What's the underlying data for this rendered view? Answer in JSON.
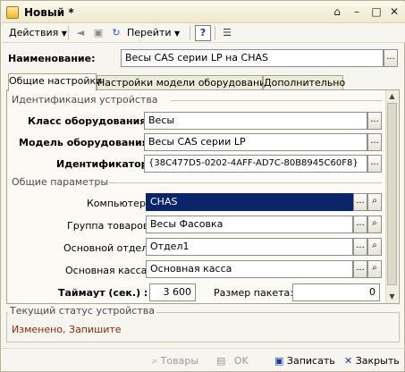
{
  "window": {
    "title": "Новый *"
  },
  "toolbar": {
    "actions_label": "Действия",
    "goto_label": "Перейти",
    "help_label": "?"
  },
  "name_row": {
    "label": "Наименование:",
    "value": "Весы CAS серии LP на CHAS"
  },
  "tabs": [
    {
      "label": "Общие настройки"
    },
    {
      "label": "Настройки модели оборудования"
    },
    {
      "label": "Дополнительно"
    }
  ],
  "device_id_section": {
    "title": "Идентификация устройства",
    "class_label": "Класс оборудования :",
    "class_value": "Весы",
    "model_label": "Модель оборудования :",
    "model_value": "Весы CAS серии LP",
    "id_label": "Идентификатор :",
    "id_value": "{38C477D5-0202-4AFF-AD7C-80B8945C60F8}"
  },
  "general_section": {
    "title": "Общие параметры",
    "computer_label": "Компьютер :",
    "computer_value": "CHAS",
    "group_label": "Группа товаров :",
    "group_value": "Весы Фасовка",
    "dept_label": "Основной отдел :",
    "dept_value": "Отдел1",
    "cash_label": "Основная касса :",
    "cash_value": "Основная касса",
    "timeout_label": "Таймаут (сек.) :",
    "timeout_value": "3 600",
    "packet_label": "Размер пакета:",
    "packet_value": "0"
  },
  "status": {
    "title": "Текущий статус устройства",
    "text": "Изменено, Запишите"
  },
  "bottom_bar": {
    "goods_label": "Товары",
    "ok_label": "OK",
    "save_label": "Записать",
    "close_label": "Закрыть"
  },
  "icons": {
    "ellipsis": "...",
    "search": "🔍"
  }
}
